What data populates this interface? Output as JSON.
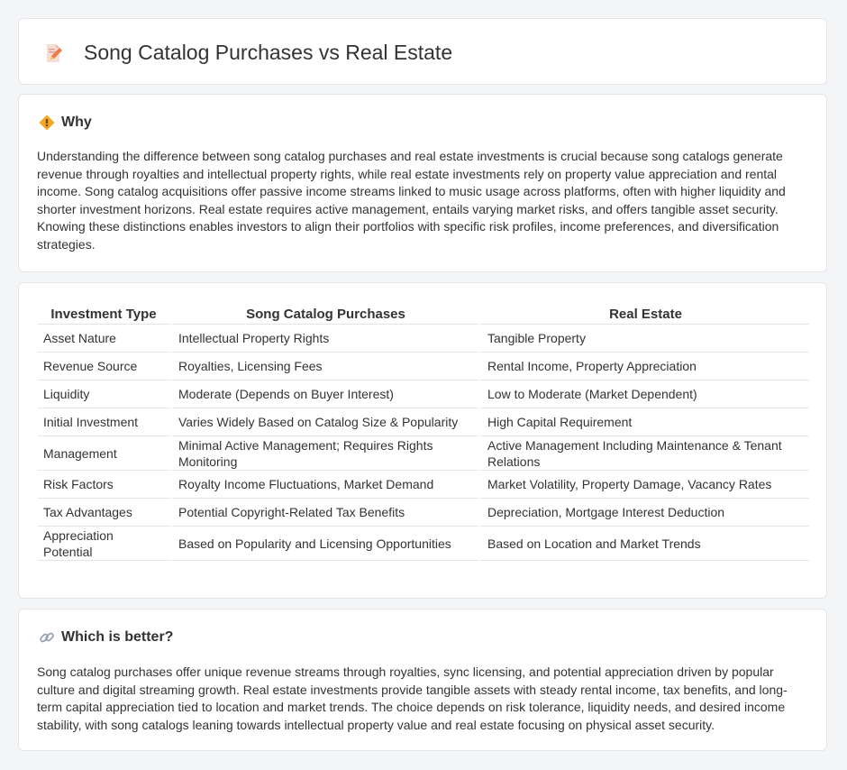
{
  "header": {
    "title": "Song Catalog Purchases vs Real Estate",
    "icon": "document-pencil-icon"
  },
  "why": {
    "heading": "Why",
    "icon": "diamond-sign-icon",
    "text": "Understanding the difference between song catalog purchases and real estate investments is crucial because song catalogs generate revenue through royalties and intellectual property rights, while real estate investments rely on property value appreciation and rental income. Song catalog acquisitions offer passive income streams linked to music usage across platforms, often with higher liquidity and shorter investment horizons. Real estate requires active management, entails varying market risks, and offers tangible asset security. Knowing these distinctions enables investors to align their portfolios with specific risk profiles, income preferences, and diversification strategies."
  },
  "table": {
    "headers": [
      "Investment Type",
      "Song Catalog Purchases",
      "Real Estate"
    ],
    "rows": [
      [
        "Asset Nature",
        "Intellectual Property Rights",
        "Tangible Property"
      ],
      [
        "Revenue Source",
        "Royalties, Licensing Fees",
        "Rental Income, Property Appreciation"
      ],
      [
        "Liquidity",
        "Moderate (Depends on Buyer Interest)",
        "Low to Moderate (Market Dependent)"
      ],
      [
        "Initial Investment",
        "Varies Widely Based on Catalog Size & Popularity",
        "High Capital Requirement"
      ],
      [
        "Management",
        "Minimal Active Management; Requires Rights Monitoring",
        "Active Management Including Maintenance & Tenant Relations"
      ],
      [
        "Risk Factors",
        "Royalty Income Fluctuations, Market Demand",
        "Market Volatility, Property Damage, Vacancy Rates"
      ],
      [
        "Tax Advantages",
        "Potential Copyright-Related Tax Benefits",
        "Depreciation, Mortgage Interest Deduction"
      ],
      [
        "Appreciation Potential",
        "Based on Popularity and Licensing Opportunities",
        "Based on Location and Market Trends"
      ]
    ]
  },
  "better": {
    "heading": "Which is better?",
    "icon": "link-icon",
    "text": "Song catalog purchases offer unique revenue streams through royalties, sync licensing, and potential appreciation driven by popular culture and digital streaming growth. Real estate investments provide tangible assets with steady rental income, tax benefits, and long-term capital appreciation tied to location and market trends. The choice depends on risk tolerance, liquidity needs, and desired income stability, with song catalogs leaning towards intellectual property value and real estate focusing on physical asset security."
  }
}
